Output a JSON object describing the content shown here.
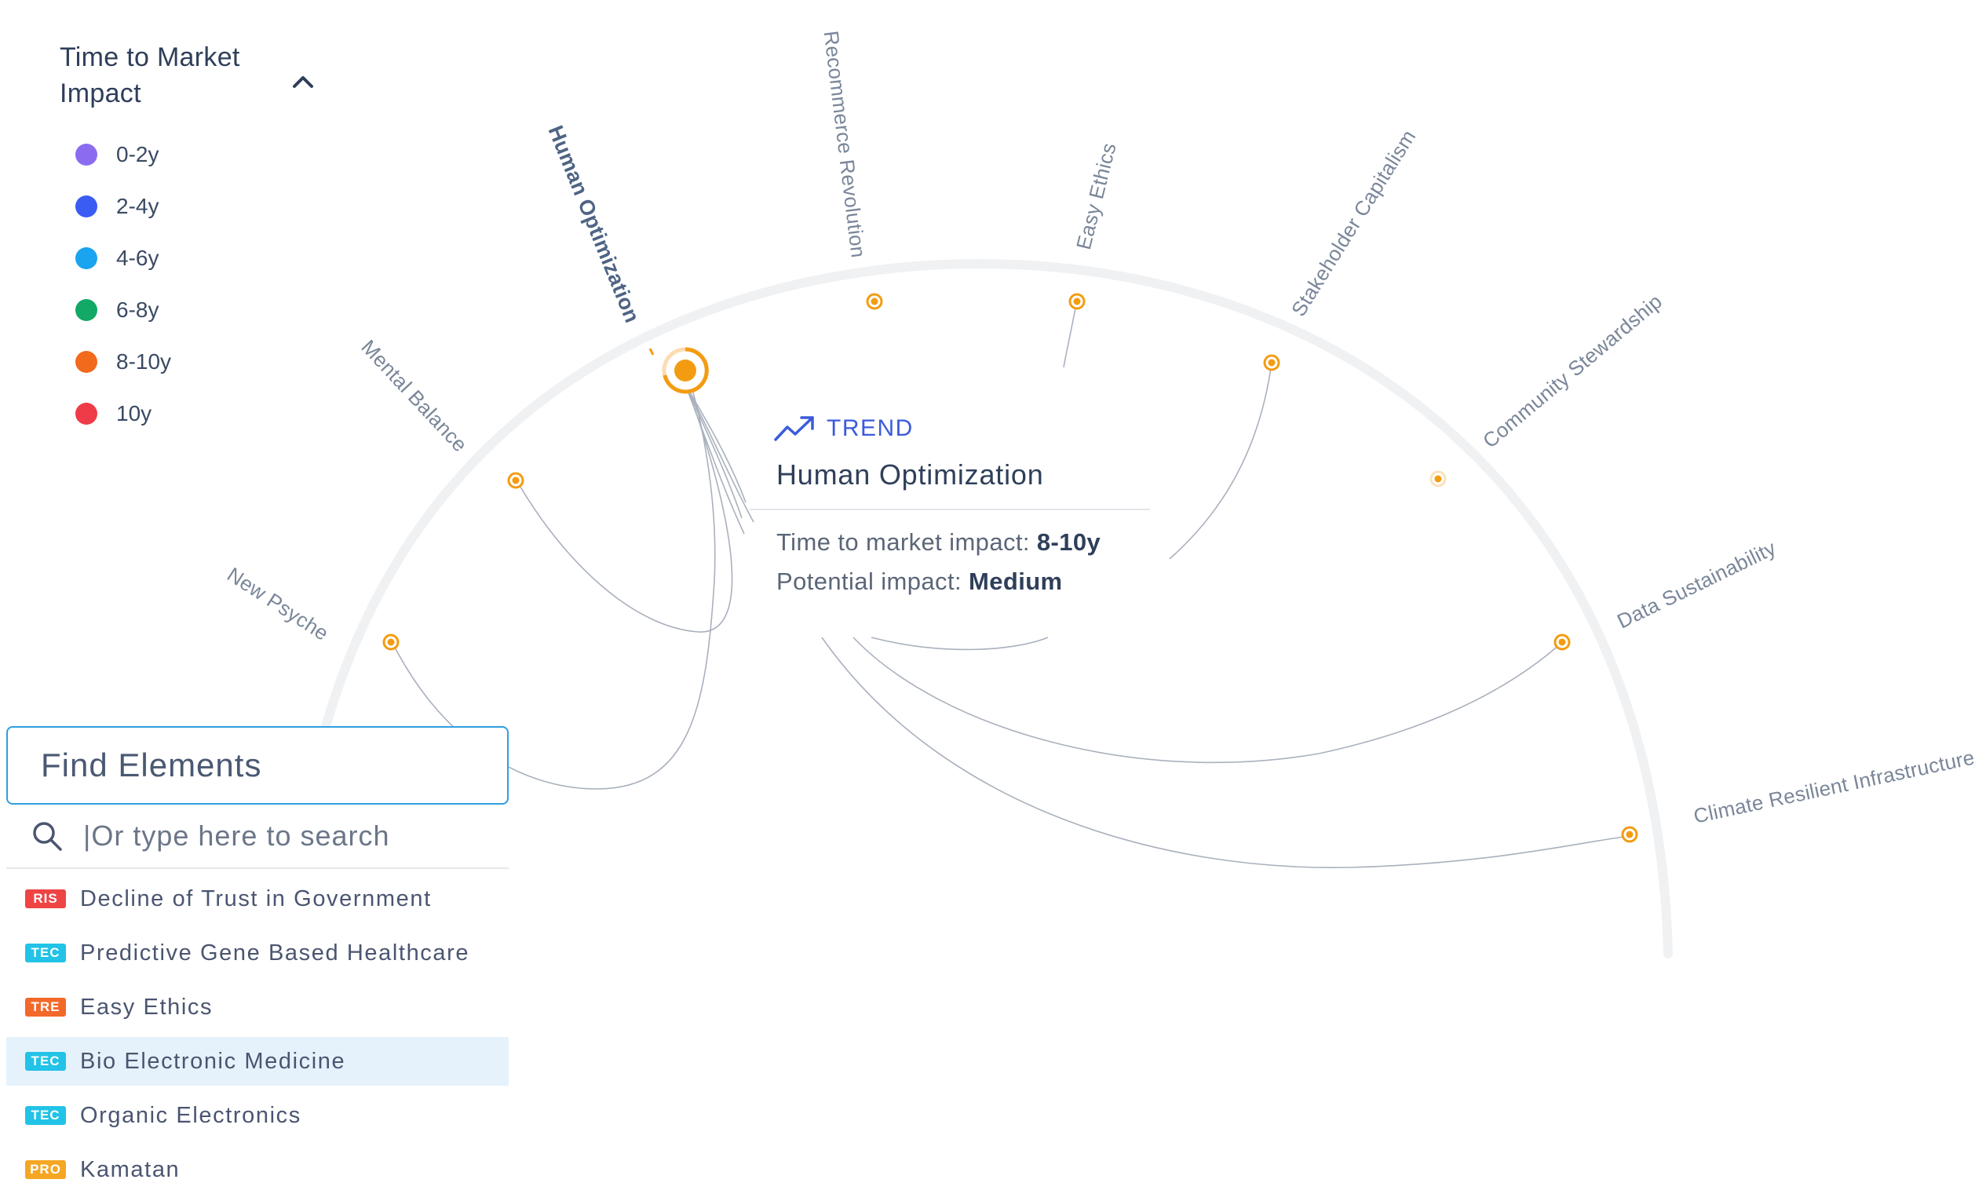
{
  "legend": {
    "title": "Time to Market Impact",
    "items": [
      {
        "label": "0-2y",
        "color": "#8b6cf0"
      },
      {
        "label": "2-4y",
        "color": "#3b5cf2"
      },
      {
        "label": "4-6y",
        "color": "#1aa3ee"
      },
      {
        "label": "6-8y",
        "color": "#12a865"
      },
      {
        "label": "8-10y",
        "color": "#f26a1b"
      },
      {
        "label": "10y",
        "color": "#ef3b48"
      }
    ]
  },
  "radar": {
    "axes": [
      {
        "label": "New Psyche",
        "active": false
      },
      {
        "label": "Mental Balance",
        "active": false
      },
      {
        "label": "Human Optimization",
        "active": true
      },
      {
        "label": "Recommerce Revolution",
        "active": false
      },
      {
        "label": "Easy Ethics",
        "active": false
      },
      {
        "label": "Stakeholder Capitalism",
        "active": false
      },
      {
        "label": "Community Stewardship",
        "active": false
      },
      {
        "label": "Data Sustainability",
        "active": false
      },
      {
        "label": "Climate Resilient Infrastructure",
        "active": false
      }
    ],
    "node_color": "#f39c12"
  },
  "tooltip": {
    "type": "TREND",
    "title": "Human Optimization",
    "time_label": "Time to market impact:",
    "time_value": "8-10y",
    "impact_label": "Potential impact:",
    "impact_value": "Medium"
  },
  "find": {
    "title": "Find Elements",
    "search_placeholder": "|Or type here to search",
    "results": [
      {
        "badge": "RIS",
        "badge_color": "#ef4444",
        "label": "Decline of Trust in Government",
        "highlight": false
      },
      {
        "badge": "TEC",
        "badge_color": "#22c3e6",
        "label": "Predictive Gene Based Healthcare",
        "highlight": false
      },
      {
        "badge": "TRE",
        "badge_color": "#f2692a",
        "label": "Easy Ethics",
        "highlight": false
      },
      {
        "badge": "TEC",
        "badge_color": "#22c3e6",
        "label": "Bio Electronic Medicine",
        "highlight": true
      },
      {
        "badge": "TEC",
        "badge_color": "#22c3e6",
        "label": "Organic Electronics",
        "highlight": false
      },
      {
        "badge": "PRO",
        "badge_color": "#f5a623",
        "label": "Kamatan",
        "highlight": false
      }
    ]
  }
}
